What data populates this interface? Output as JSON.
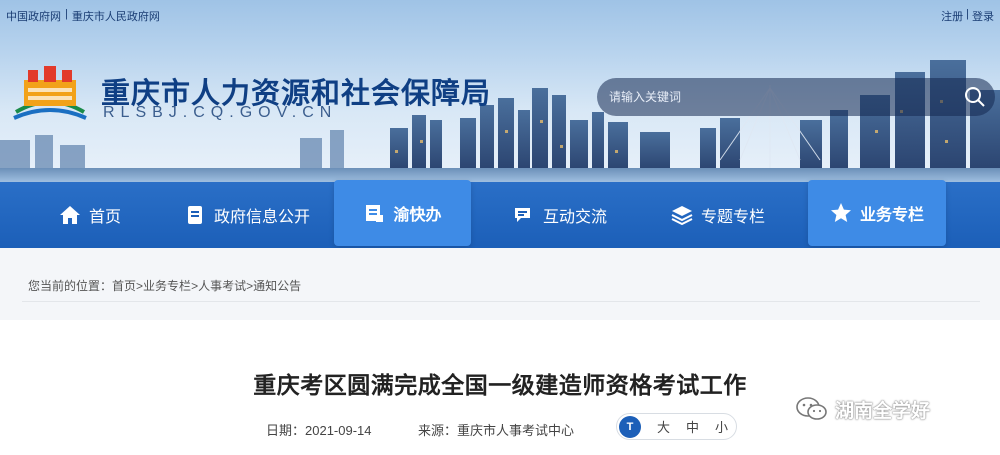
{
  "top_bar": {
    "left_links": [
      "中国政府网",
      "|",
      "重庆市人民政府网"
    ],
    "right_links": [
      "注册",
      "|",
      "登录"
    ]
  },
  "header": {
    "title": "重庆市人力资源和社会保障局",
    "domain": "RLSBJ.CQ.GOV.CN",
    "search_placeholder": "请输入关键词"
  },
  "nav": {
    "items": [
      {
        "label": "首页",
        "icon": "home-icon"
      },
      {
        "label": "政府信息公开",
        "icon": "document-icon"
      },
      {
        "label": "渝快办",
        "icon": "service-icon",
        "active": true
      },
      {
        "label": "互动交流",
        "icon": "chat-icon"
      },
      {
        "label": "专题专栏",
        "icon": "layers-icon"
      },
      {
        "label": "业务专栏",
        "icon": "star-icon",
        "active": true
      }
    ]
  },
  "breadcrumb": {
    "prefix": "您当前的位置：",
    "items": [
      "首页",
      "业务专栏",
      "人事考试",
      "通知公告"
    ],
    "separator": ">"
  },
  "article": {
    "title": "重庆考区圆满完成全国一级建造师资格考试工作",
    "date_label": "日期：",
    "date": "2021-09-14",
    "source_label": "来源：",
    "source": "重庆市人事考试中心",
    "font_sizes": [
      "大",
      "中",
      "小"
    ],
    "font_icon_text": "T"
  },
  "watermark": {
    "text": "湖南全学好"
  },
  "colors": {
    "nav_bg": "#1c5fb8",
    "nav_active": "#3e8be6",
    "title_blue": "#0f3f84"
  }
}
